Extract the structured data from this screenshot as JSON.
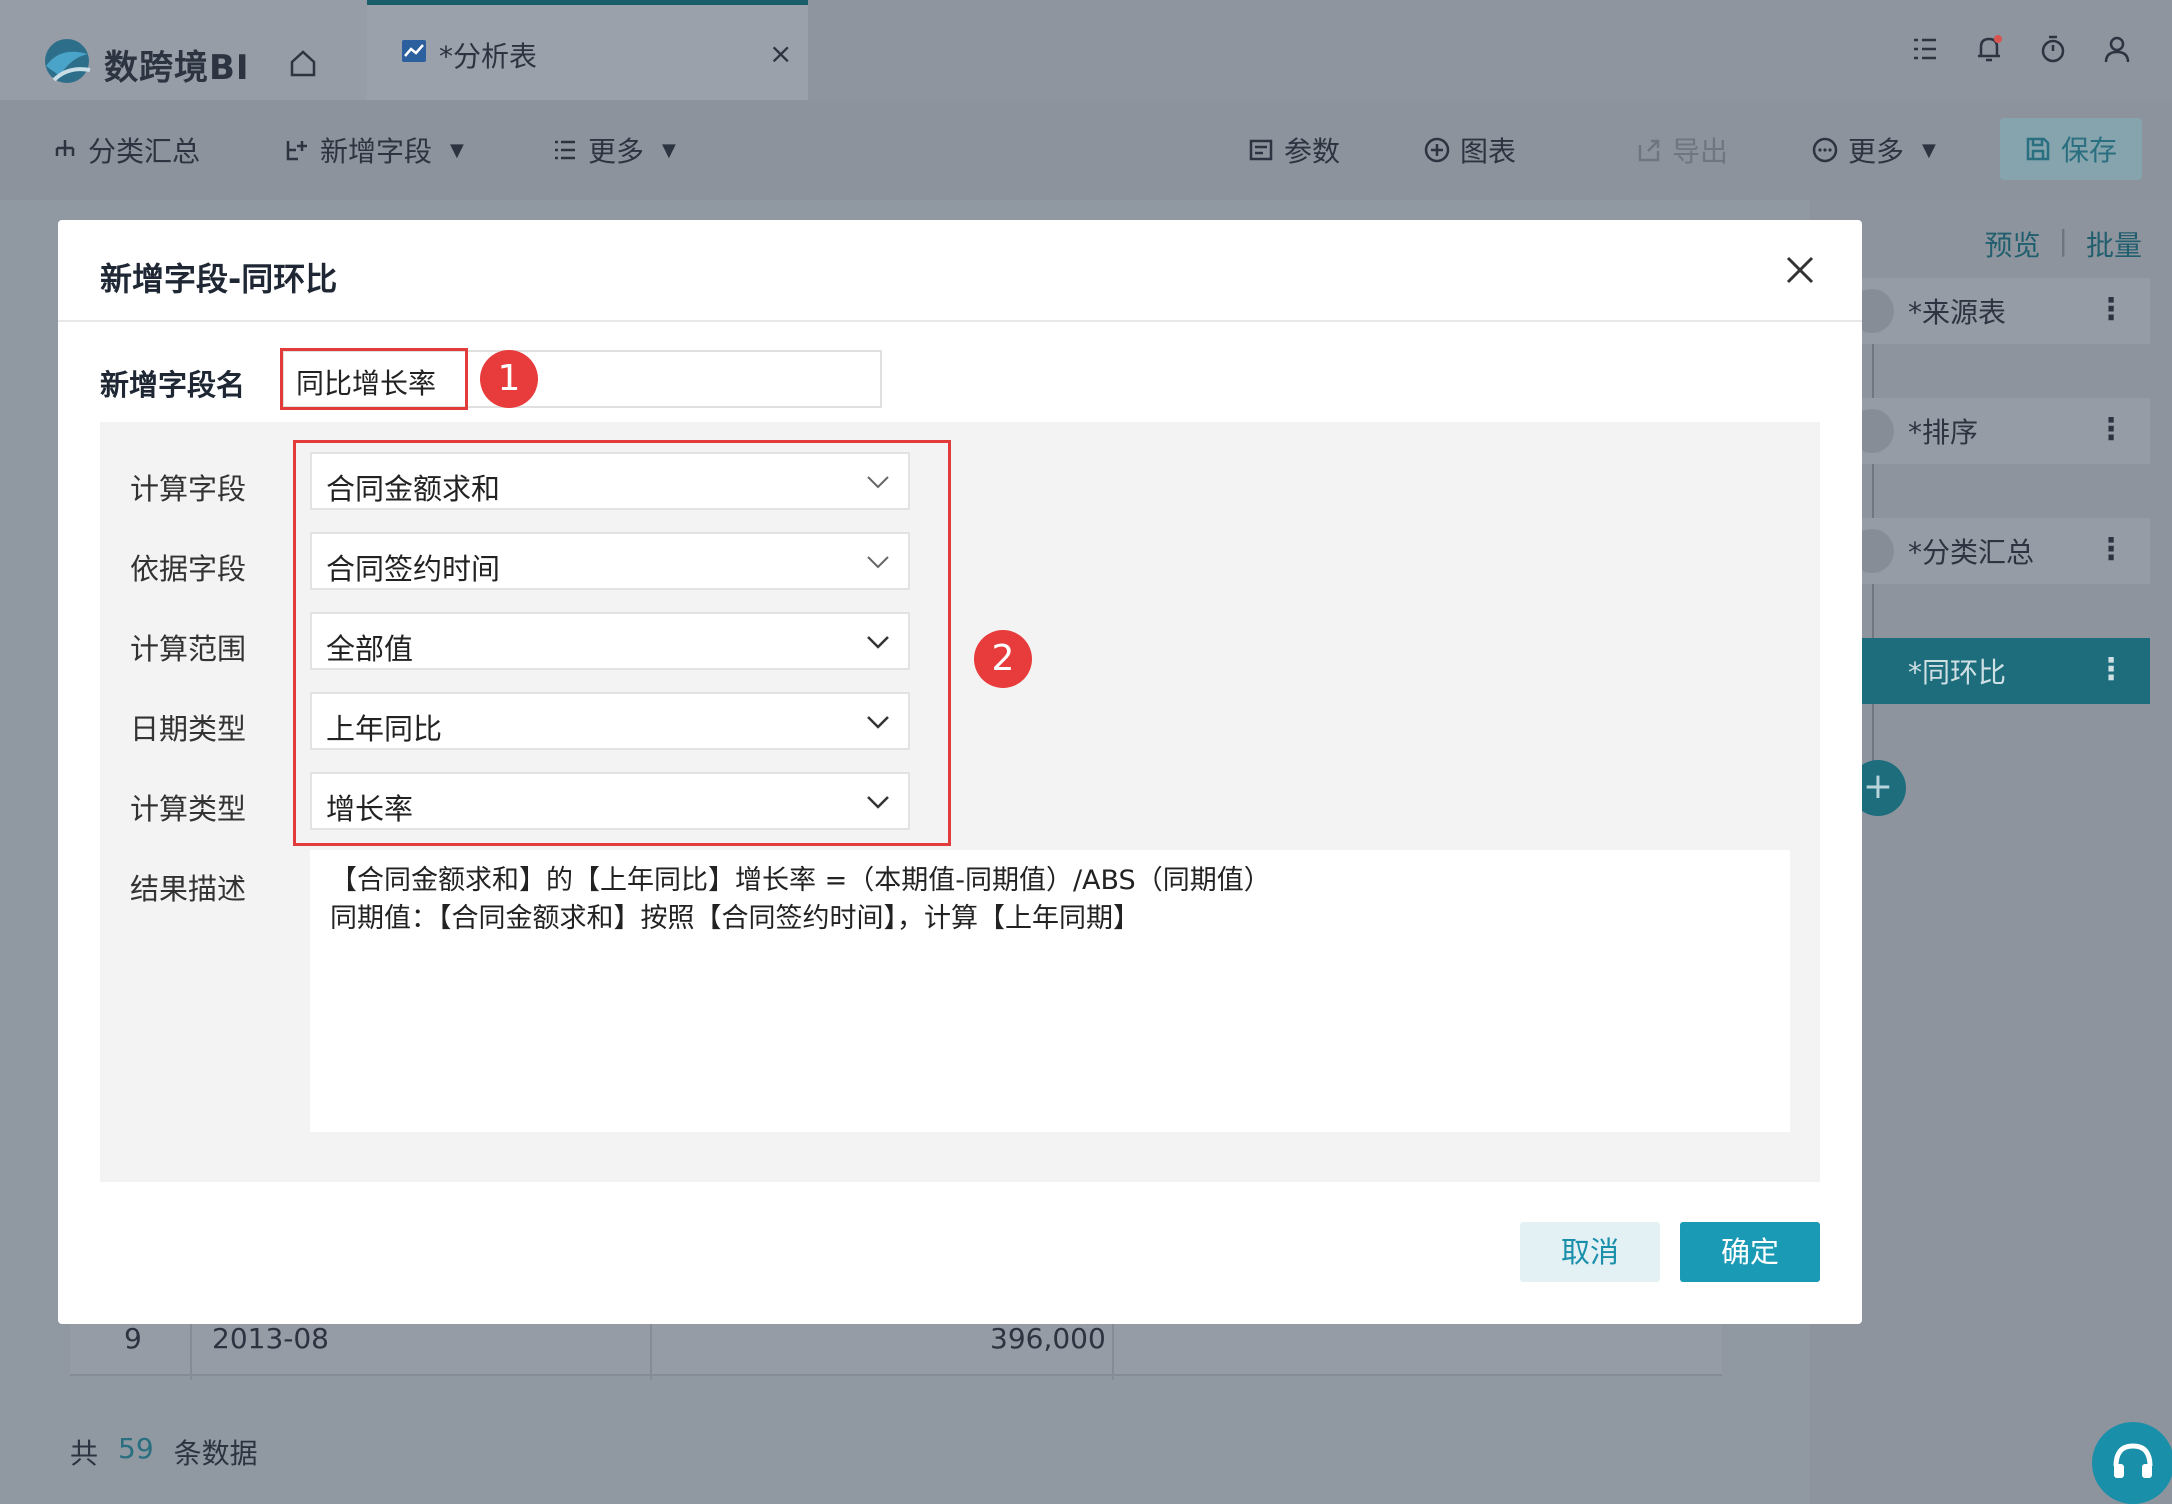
{
  "app": {
    "logo_text": "数跨境BI",
    "tab_title": "*分析表",
    "tab_close": "×"
  },
  "toolbar": {
    "left": [
      {
        "label": "分类汇总",
        "icon": "hierarchy-icon"
      },
      {
        "label": "新增字段",
        "icon": "add-field-icon"
      },
      {
        "label": "更多",
        "icon": "list-icon"
      }
    ],
    "right": [
      {
        "label": "参数",
        "icon": "param-icon"
      },
      {
        "label": "图表",
        "icon": "plus-circle-icon"
      },
      {
        "label": "导出",
        "icon": "export-icon"
      },
      {
        "label": "更多",
        "icon": "more-circle-icon"
      }
    ],
    "save_label": "保存"
  },
  "right_panel": {
    "preview_label": "预览",
    "batch_label": "批量",
    "sep": "|",
    "nodes": [
      {
        "label": "*来源表"
      },
      {
        "label": "*排序"
      },
      {
        "label": "*分类汇总"
      },
      {
        "label": "*同环比"
      }
    ],
    "add_symbol": "+"
  },
  "table": {
    "row": {
      "index": "9",
      "date": "2013-08",
      "value": "396,000"
    }
  },
  "footer": {
    "prefix": "共",
    "count": "59",
    "suffix": "条数据"
  },
  "modal": {
    "title": "新增字段-同环比",
    "name_label": "新增字段名",
    "name_value": "同比增长率",
    "badge1": "1",
    "badge2": "2",
    "fields": [
      {
        "label": "计算字段",
        "value": "合同金额求和"
      },
      {
        "label": "依据字段",
        "value": "合同签约时间"
      },
      {
        "label": "计算范围",
        "value": "全部值"
      },
      {
        "label": "日期类型",
        "value": "上年同比"
      },
      {
        "label": "计算类型",
        "value": "增长率"
      }
    ],
    "desc_label": "结果描述",
    "desc_line1": "【合同金额求和】的【上年同比】增长率 =（本期值-同期值）/ABS（同期值）",
    "desc_line2": "同期值：【合同金额求和】按照【合同签约时间】，计算【上年同期】",
    "cancel_label": "取消",
    "ok_label": "确定"
  },
  "colors": {
    "accent": "#1a9ab5",
    "highlight_red": "#e23b3b",
    "overlay": "#9098a2"
  }
}
